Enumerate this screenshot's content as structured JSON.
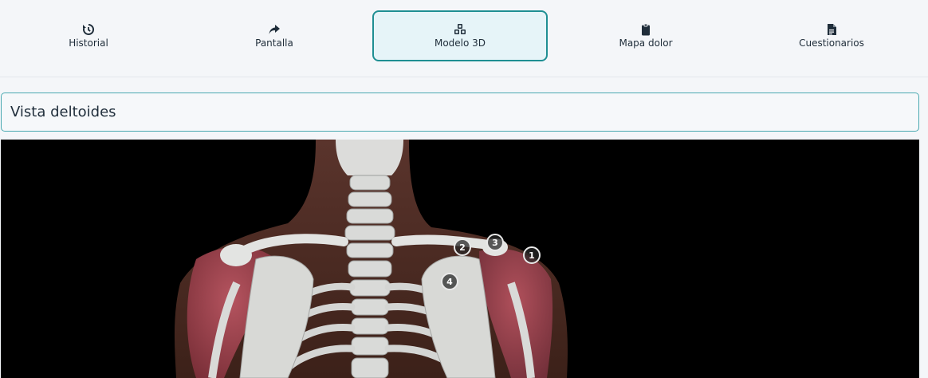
{
  "tabs": [
    {
      "label": "Historial",
      "icon": "history-icon"
    },
    {
      "label": "Pantalla",
      "icon": "share-arrow-icon"
    },
    {
      "label": "Modelo 3D",
      "icon": "cubes-icon",
      "active": true
    },
    {
      "label": "Mapa dolor",
      "icon": "clipboard-icon"
    },
    {
      "label": "Cuestionarios",
      "icon": "document-icon"
    }
  ],
  "section": {
    "title": "Vista deltoides"
  },
  "model": {
    "markers": [
      {
        "label": "1"
      },
      {
        "label": "2"
      },
      {
        "label": "3"
      },
      {
        "label": "4"
      }
    ]
  },
  "colors": {
    "accent": "#1f8f93",
    "active_bg": "#e6f4f8",
    "muscle": "#a84955",
    "bone": "#d9dad8"
  }
}
